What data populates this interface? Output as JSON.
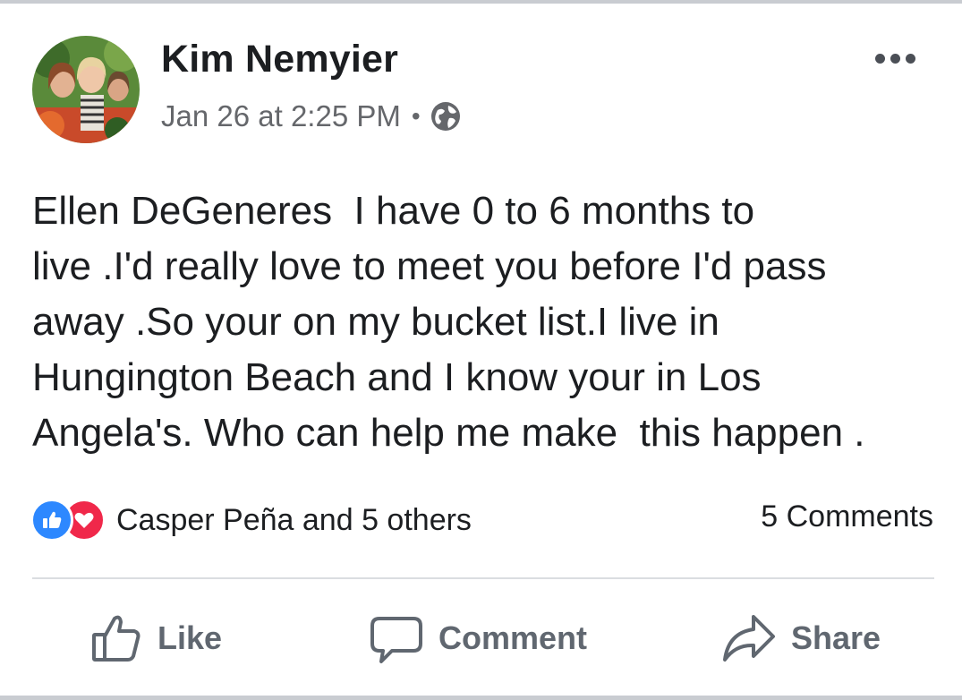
{
  "post": {
    "author": "Kim Nemyier",
    "timestamp": "Jan 26 at 2:25 PM",
    "separator": "•",
    "privacy_icon": "globe-icon",
    "more_icon": "more-dots-icon",
    "text_lines": [
      "Ellen DeGeneres  I have 0 to 6 months to",
      "live .I'd really love to meet you before I'd pass",
      "away .So your on my bucket list.I live in",
      "Hungington Beach and I know your in Los",
      "Angela's. Who can help me make  this happen ."
    ]
  },
  "reactions": {
    "icons": [
      "like-reaction-icon",
      "love-reaction-icon"
    ],
    "names": "Casper Peña and 5 others",
    "comments": "5 Comments"
  },
  "actions": {
    "like": {
      "label": "Like",
      "icon": "thumbs-up-icon"
    },
    "comment": {
      "label": "Comment",
      "icon": "comment-bubble-icon"
    },
    "share": {
      "label": "Share",
      "icon": "share-arrow-icon"
    }
  },
  "colors": {
    "text": "#1c1e21",
    "meta": "#65676b",
    "action": "#606770",
    "like_blue": "#2d88ff",
    "love_red": "#f0284a",
    "divider": "#dadde1"
  }
}
